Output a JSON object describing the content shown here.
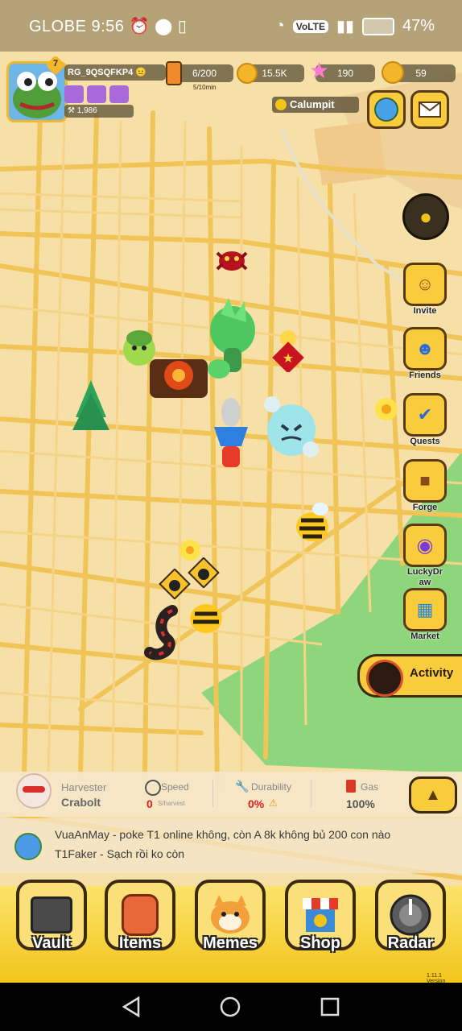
{
  "status_bar": {
    "carrier": "GLOBE",
    "time": "9:56",
    "volte": "VoLTE",
    "battery": "47%"
  },
  "player": {
    "level": "7",
    "name": "RG_9QSQFKP4",
    "score": "1,986"
  },
  "resources": {
    "energy": "6/200",
    "energy_rate": "5/10min",
    "coins": "15.5K",
    "stars": "190",
    "gold": "59"
  },
  "location": {
    "name": "Calumpit"
  },
  "side_menu": [
    {
      "label": "Invite"
    },
    {
      "label": "Friends"
    },
    {
      "label": "Quests"
    },
    {
      "label": "Forge"
    },
    {
      "label": "LuckyDr aw"
    },
    {
      "label": "Market"
    }
  ],
  "activity": {
    "label": "Activity"
  },
  "harvester": {
    "title": "Harvester",
    "name": "Crabolt",
    "speed_label": "Speed",
    "speed_value": "0",
    "speed_unit": "S/harvest",
    "durability_label": "Durability",
    "durability_value": "0%",
    "gas_label": "Gas",
    "gas_value": "100%"
  },
  "chat": [
    {
      "user": "VuaAnMay",
      "message": " - poke T1 online không, còn A 8k không bủ 200 con nào"
    },
    {
      "user": "T1Faker",
      "message": " - Sạch rồi ko còn"
    }
  ],
  "bottom_nav": [
    {
      "label": "Vault"
    },
    {
      "label": "Items"
    },
    {
      "label": "Memes"
    },
    {
      "label": "Shop"
    },
    {
      "label": "Radar"
    }
  ],
  "version": "1.11.1 Version",
  "colors": {
    "map_bg": "#f5dca0",
    "road": "#f2c75c",
    "park": "#8fd07a",
    "accent": "#f8cc3c",
    "nav_bar": "#f3c51c"
  }
}
